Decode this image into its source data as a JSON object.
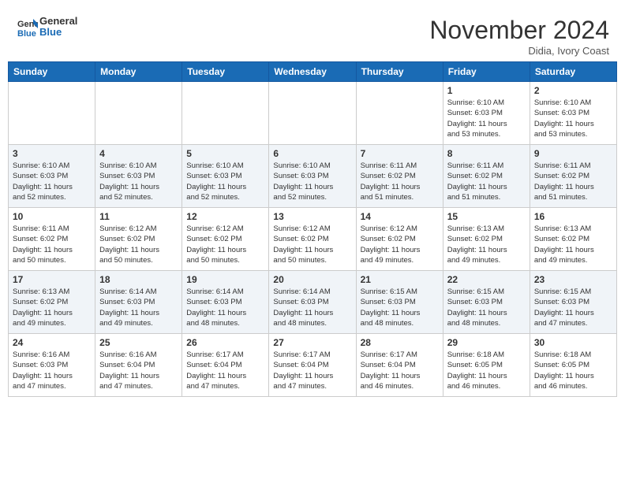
{
  "header": {
    "logo_line1": "General",
    "logo_line2": "Blue",
    "month_title": "November 2024",
    "location": "Didia, Ivory Coast"
  },
  "weekdays": [
    "Sunday",
    "Monday",
    "Tuesday",
    "Wednesday",
    "Thursday",
    "Friday",
    "Saturday"
  ],
  "weeks": [
    [
      {
        "day": "",
        "info": ""
      },
      {
        "day": "",
        "info": ""
      },
      {
        "day": "",
        "info": ""
      },
      {
        "day": "",
        "info": ""
      },
      {
        "day": "",
        "info": ""
      },
      {
        "day": "1",
        "info": "Sunrise: 6:10 AM\nSunset: 6:03 PM\nDaylight: 11 hours\nand 53 minutes."
      },
      {
        "day": "2",
        "info": "Sunrise: 6:10 AM\nSunset: 6:03 PM\nDaylight: 11 hours\nand 53 minutes."
      }
    ],
    [
      {
        "day": "3",
        "info": "Sunrise: 6:10 AM\nSunset: 6:03 PM\nDaylight: 11 hours\nand 52 minutes."
      },
      {
        "day": "4",
        "info": "Sunrise: 6:10 AM\nSunset: 6:03 PM\nDaylight: 11 hours\nand 52 minutes."
      },
      {
        "day": "5",
        "info": "Sunrise: 6:10 AM\nSunset: 6:03 PM\nDaylight: 11 hours\nand 52 minutes."
      },
      {
        "day": "6",
        "info": "Sunrise: 6:10 AM\nSunset: 6:03 PM\nDaylight: 11 hours\nand 52 minutes."
      },
      {
        "day": "7",
        "info": "Sunrise: 6:11 AM\nSunset: 6:02 PM\nDaylight: 11 hours\nand 51 minutes."
      },
      {
        "day": "8",
        "info": "Sunrise: 6:11 AM\nSunset: 6:02 PM\nDaylight: 11 hours\nand 51 minutes."
      },
      {
        "day": "9",
        "info": "Sunrise: 6:11 AM\nSunset: 6:02 PM\nDaylight: 11 hours\nand 51 minutes."
      }
    ],
    [
      {
        "day": "10",
        "info": "Sunrise: 6:11 AM\nSunset: 6:02 PM\nDaylight: 11 hours\nand 50 minutes."
      },
      {
        "day": "11",
        "info": "Sunrise: 6:12 AM\nSunset: 6:02 PM\nDaylight: 11 hours\nand 50 minutes."
      },
      {
        "day": "12",
        "info": "Sunrise: 6:12 AM\nSunset: 6:02 PM\nDaylight: 11 hours\nand 50 minutes."
      },
      {
        "day": "13",
        "info": "Sunrise: 6:12 AM\nSunset: 6:02 PM\nDaylight: 11 hours\nand 50 minutes."
      },
      {
        "day": "14",
        "info": "Sunrise: 6:12 AM\nSunset: 6:02 PM\nDaylight: 11 hours\nand 49 minutes."
      },
      {
        "day": "15",
        "info": "Sunrise: 6:13 AM\nSunset: 6:02 PM\nDaylight: 11 hours\nand 49 minutes."
      },
      {
        "day": "16",
        "info": "Sunrise: 6:13 AM\nSunset: 6:02 PM\nDaylight: 11 hours\nand 49 minutes."
      }
    ],
    [
      {
        "day": "17",
        "info": "Sunrise: 6:13 AM\nSunset: 6:02 PM\nDaylight: 11 hours\nand 49 minutes."
      },
      {
        "day": "18",
        "info": "Sunrise: 6:14 AM\nSunset: 6:03 PM\nDaylight: 11 hours\nand 49 minutes."
      },
      {
        "day": "19",
        "info": "Sunrise: 6:14 AM\nSunset: 6:03 PM\nDaylight: 11 hours\nand 48 minutes."
      },
      {
        "day": "20",
        "info": "Sunrise: 6:14 AM\nSunset: 6:03 PM\nDaylight: 11 hours\nand 48 minutes."
      },
      {
        "day": "21",
        "info": "Sunrise: 6:15 AM\nSunset: 6:03 PM\nDaylight: 11 hours\nand 48 minutes."
      },
      {
        "day": "22",
        "info": "Sunrise: 6:15 AM\nSunset: 6:03 PM\nDaylight: 11 hours\nand 48 minutes."
      },
      {
        "day": "23",
        "info": "Sunrise: 6:15 AM\nSunset: 6:03 PM\nDaylight: 11 hours\nand 47 minutes."
      }
    ],
    [
      {
        "day": "24",
        "info": "Sunrise: 6:16 AM\nSunset: 6:03 PM\nDaylight: 11 hours\nand 47 minutes."
      },
      {
        "day": "25",
        "info": "Sunrise: 6:16 AM\nSunset: 6:04 PM\nDaylight: 11 hours\nand 47 minutes."
      },
      {
        "day": "26",
        "info": "Sunrise: 6:17 AM\nSunset: 6:04 PM\nDaylight: 11 hours\nand 47 minutes."
      },
      {
        "day": "27",
        "info": "Sunrise: 6:17 AM\nSunset: 6:04 PM\nDaylight: 11 hours\nand 47 minutes."
      },
      {
        "day": "28",
        "info": "Sunrise: 6:17 AM\nSunset: 6:04 PM\nDaylight: 11 hours\nand 46 minutes."
      },
      {
        "day": "29",
        "info": "Sunrise: 6:18 AM\nSunset: 6:05 PM\nDaylight: 11 hours\nand 46 minutes."
      },
      {
        "day": "30",
        "info": "Sunrise: 6:18 AM\nSunset: 6:05 PM\nDaylight: 11 hours\nand 46 minutes."
      }
    ]
  ]
}
